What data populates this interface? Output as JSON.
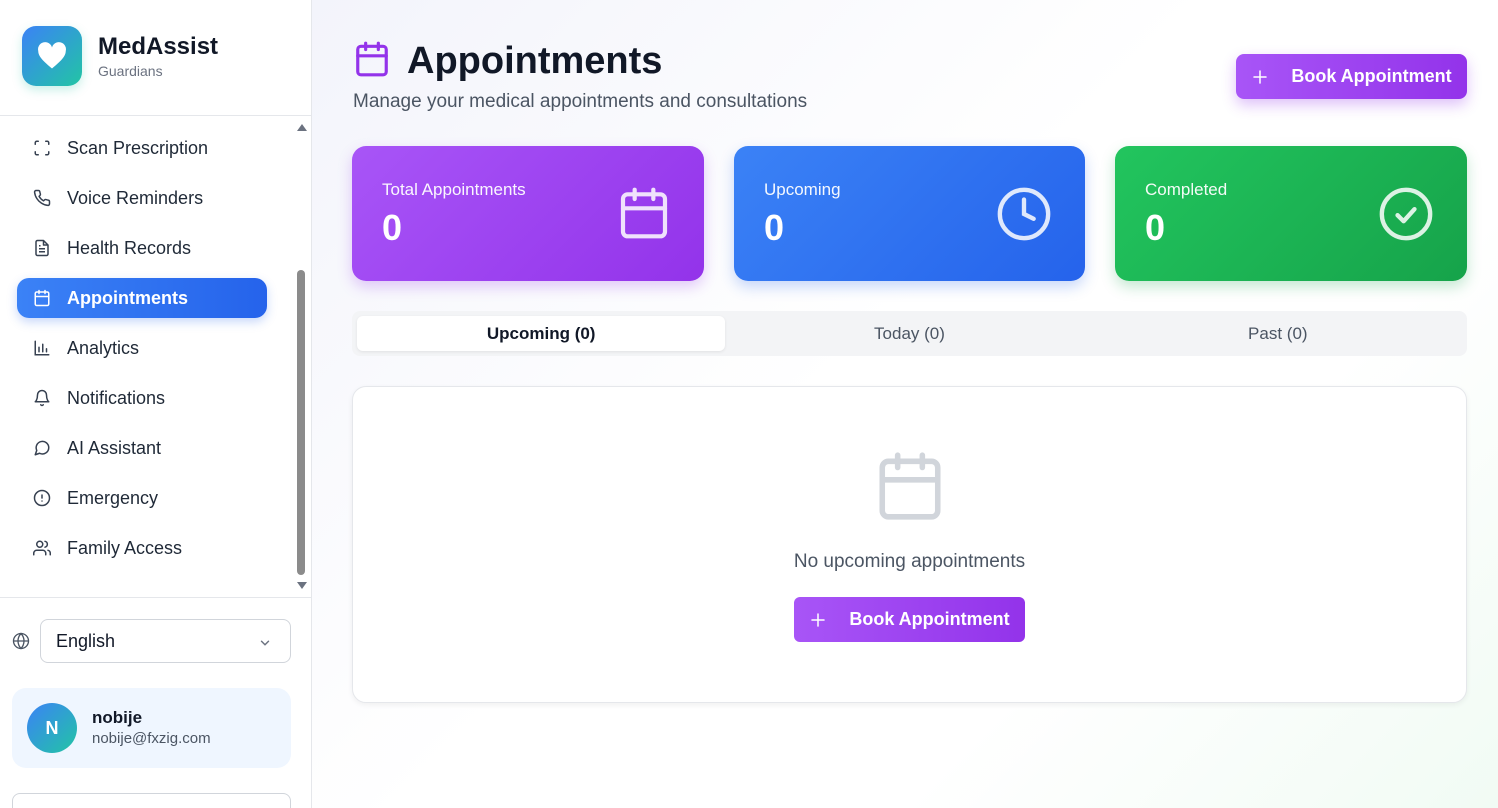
{
  "app": {
    "title": "MedAssist",
    "subtitle": "Guardians",
    "logo_icon": "heart-icon"
  },
  "sidebar": {
    "items": [
      {
        "label": "Scan Prescription",
        "icon": "scan-icon"
      },
      {
        "label": "Voice Reminders",
        "icon": "phone-icon"
      },
      {
        "label": "Health Records",
        "icon": "file-text-icon"
      },
      {
        "label": "Appointments",
        "icon": "calendar-icon",
        "active": true
      },
      {
        "label": "Analytics",
        "icon": "bar-chart-icon"
      },
      {
        "label": "Notifications",
        "icon": "bell-icon"
      },
      {
        "label": "AI Assistant",
        "icon": "message-circle-icon"
      },
      {
        "label": "Emergency",
        "icon": "alert-circle-icon"
      },
      {
        "label": "Family Access",
        "icon": "users-icon"
      }
    ],
    "language": {
      "selected": "English"
    },
    "user": {
      "initial": "N",
      "name": "nobije",
      "email": "nobije@fxzig.com"
    }
  },
  "header": {
    "title": "Appointments",
    "subtitle": "Manage your medical appointments and consultations",
    "book_button": "Book Appointment"
  },
  "stats": {
    "total": {
      "label": "Total Appointments",
      "value": "0"
    },
    "upcoming": {
      "label": "Upcoming",
      "value": "0"
    },
    "completed": {
      "label": "Completed",
      "value": "0"
    }
  },
  "tabs": [
    {
      "label": "Upcoming (0)",
      "active": true
    },
    {
      "label": "Today (0)"
    },
    {
      "label": "Past (0)"
    }
  ],
  "empty_state": {
    "message": "No upcoming appointments",
    "button": "Book Appointment"
  },
  "colors": {
    "purple": "#9333ea",
    "blue": "#2563eb",
    "green": "#16a34a"
  }
}
